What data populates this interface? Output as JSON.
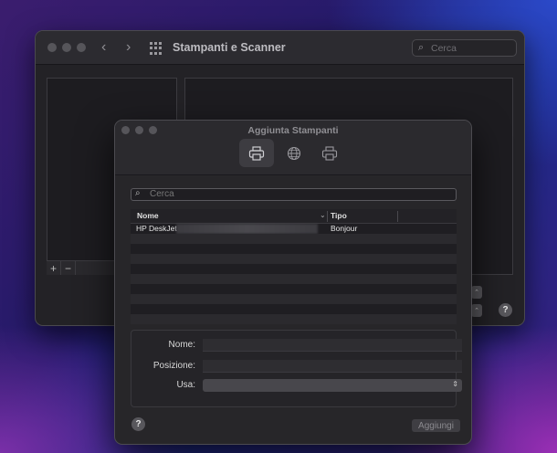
{
  "background_window": {
    "title": "Stampanti e Scanner",
    "search_placeholder": "Cerca",
    "back_glyph": "‹",
    "forward_glyph": "›",
    "add_glyph": "+",
    "remove_glyph": "−",
    "help_glyph": "?"
  },
  "dialog": {
    "title": "Aggiunta Stampanti",
    "toolbar": [
      {
        "name": "default-printer-tab",
        "icon": "printer-icon",
        "active": true
      },
      {
        "name": "ip-printer-tab",
        "icon": "globe-icon",
        "active": false
      },
      {
        "name": "windows-printer-tab",
        "icon": "printer-share-icon",
        "active": false
      }
    ],
    "search_placeholder": "Cerca",
    "table": {
      "columns": [
        "Nome",
        "Tipo"
      ],
      "rows": [
        {
          "name": "HP DeskJet",
          "type": "Bonjour"
        }
      ]
    },
    "form": {
      "name_label": "Nome:",
      "location_label": "Posizione:",
      "use_label": "Usa:"
    },
    "help_glyph": "?",
    "add_button": "Aggiungi"
  },
  "colors": {
    "window_bg": "#232226",
    "dialog_bg": "#272629",
    "accent_desktop": "#2b49c9"
  }
}
